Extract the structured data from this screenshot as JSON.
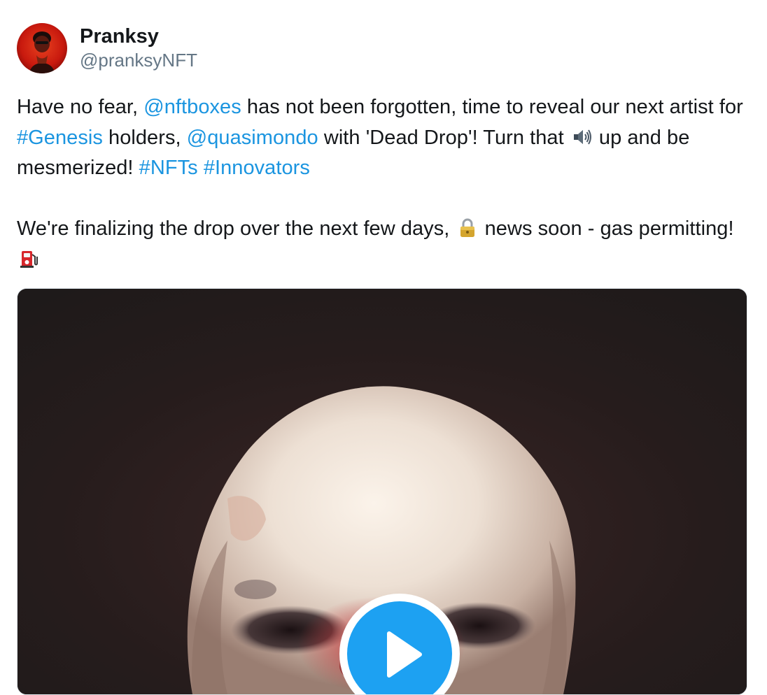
{
  "author": {
    "display_name": "Pranksy",
    "handle": "@pranksyNFT",
    "avatar": "profile-avatar"
  },
  "tweet": {
    "p1": {
      "t1": "Have no fear, ",
      "mention_nftboxes": "@nftboxes",
      "t2": " has not been forgotten, time to reveal our next artist for ",
      "hashtag_genesis": "#Genesis",
      "t3": " holders, ",
      "mention_quasimondo": "@quasimondo",
      "t4": " with 'Dead Drop'! Turn that ",
      "emoji_speaker": "speaker-loud-icon",
      "t5": " up and be mesmerized! ",
      "hashtag_nfts": "#NFTs",
      "t6": " ",
      "hashtag_innovators": "#Innovators"
    },
    "p2": {
      "t1": "We're finalizing the drop over the next few days, ",
      "emoji_lock": "lock-icon",
      "t2": " news soon - gas permitting! ",
      "emoji_fuel": "fuel-pump-icon"
    }
  },
  "media": {
    "type": "video",
    "thumbnail": "skull-video-thumbnail",
    "play_icon": "play-icon"
  },
  "colors": {
    "link": "#1b95e0",
    "text": "#14171a",
    "handle": "#657786",
    "play": "#1da1f2",
    "video_bg": "#241d1d"
  }
}
